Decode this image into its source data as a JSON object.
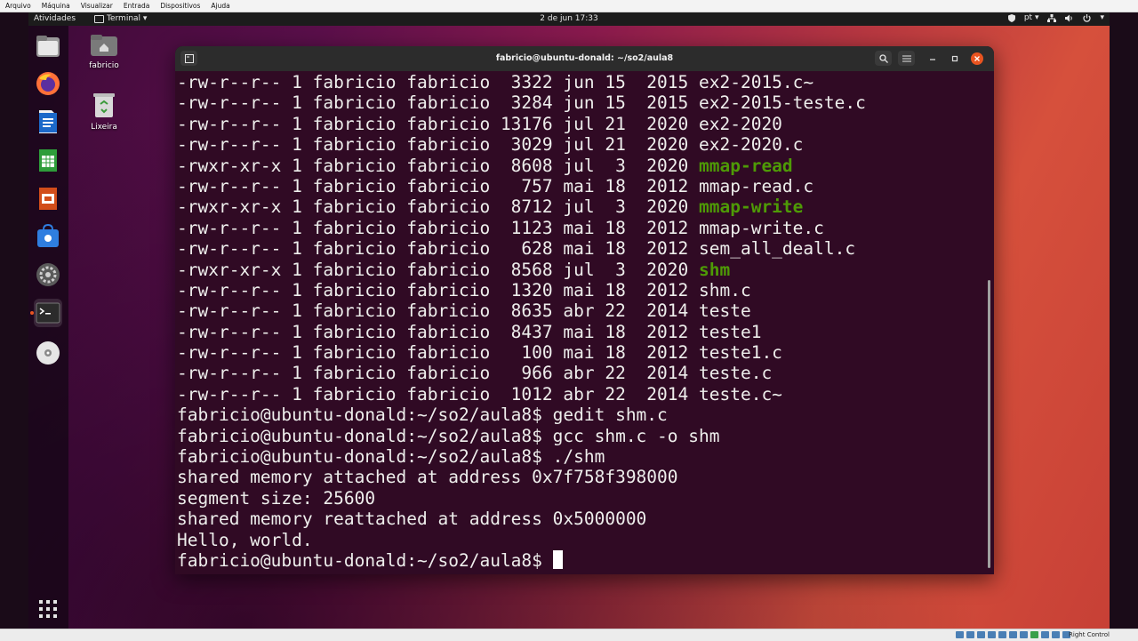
{
  "vbox": {
    "menu": [
      "Arquivo",
      "Máquina",
      "Visualizar",
      "Entrada",
      "Dispositivos",
      "Ajuda"
    ],
    "status_text": "Right Control"
  },
  "topbar": {
    "activities": "Atividades",
    "app_menu": "Terminal ▾",
    "clock": "2 de jun  17:33",
    "language": "pt ▾"
  },
  "desktop": {
    "home_label": "fabricio",
    "trash_label": "Lixeira"
  },
  "dock": {
    "items": [
      "files",
      "firefox",
      "writer",
      "calc",
      "impress",
      "software",
      "settings",
      "terminal",
      "dvd"
    ],
    "active": "terminal"
  },
  "terminal": {
    "title": "fabricio@ubuntu-donald: ~/so2/aula8",
    "listing": [
      {
        "perms": "-rw-r--r--",
        "links": "1",
        "owner": "fabricio",
        "group": "fabricio",
        "size": "3322",
        "month": "jun",
        "day": "15",
        "year": "2015",
        "name": "ex2-2015.c~",
        "exec": false
      },
      {
        "perms": "-rw-r--r--",
        "links": "1",
        "owner": "fabricio",
        "group": "fabricio",
        "size": "3284",
        "month": "jun",
        "day": "15",
        "year": "2015",
        "name": "ex2-2015-teste.c",
        "exec": false
      },
      {
        "perms": "-rw-r--r--",
        "links": "1",
        "owner": "fabricio",
        "group": "fabricio",
        "size": "13176",
        "month": "jul",
        "day": "21",
        "year": "2020",
        "name": "ex2-2020",
        "exec": false
      },
      {
        "perms": "-rw-r--r--",
        "links": "1",
        "owner": "fabricio",
        "group": "fabricio",
        "size": "3029",
        "month": "jul",
        "day": "21",
        "year": "2020",
        "name": "ex2-2020.c",
        "exec": false
      },
      {
        "perms": "-rwxr-xr-x",
        "links": "1",
        "owner": "fabricio",
        "group": "fabricio",
        "size": "8608",
        "month": "jul",
        "day": "3",
        "year": "2020",
        "name": "mmap-read",
        "exec": true
      },
      {
        "perms": "-rw-r--r--",
        "links": "1",
        "owner": "fabricio",
        "group": "fabricio",
        "size": "757",
        "month": "mai",
        "day": "18",
        "year": "2012",
        "name": "mmap-read.c",
        "exec": false
      },
      {
        "perms": "-rwxr-xr-x",
        "links": "1",
        "owner": "fabricio",
        "group": "fabricio",
        "size": "8712",
        "month": "jul",
        "day": "3",
        "year": "2020",
        "name": "mmap-write",
        "exec": true
      },
      {
        "perms": "-rw-r--r--",
        "links": "1",
        "owner": "fabricio",
        "group": "fabricio",
        "size": "1123",
        "month": "mai",
        "day": "18",
        "year": "2012",
        "name": "mmap-write.c",
        "exec": false
      },
      {
        "perms": "-rw-r--r--",
        "links": "1",
        "owner": "fabricio",
        "group": "fabricio",
        "size": "628",
        "month": "mai",
        "day": "18",
        "year": "2012",
        "name": "sem_all_deall.c",
        "exec": false
      },
      {
        "perms": "-rwxr-xr-x",
        "links": "1",
        "owner": "fabricio",
        "group": "fabricio",
        "size": "8568",
        "month": "jul",
        "day": "3",
        "year": "2020",
        "name": "shm",
        "exec": true
      },
      {
        "perms": "-rw-r--r--",
        "links": "1",
        "owner": "fabricio",
        "group": "fabricio",
        "size": "1320",
        "month": "mai",
        "day": "18",
        "year": "2012",
        "name": "shm.c",
        "exec": false
      },
      {
        "perms": "-rw-r--r--",
        "links": "1",
        "owner": "fabricio",
        "group": "fabricio",
        "size": "8635",
        "month": "abr",
        "day": "22",
        "year": "2014",
        "name": "teste",
        "exec": false
      },
      {
        "perms": "-rw-r--r--",
        "links": "1",
        "owner": "fabricio",
        "group": "fabricio",
        "size": "8437",
        "month": "mai",
        "day": "18",
        "year": "2012",
        "name": "teste1",
        "exec": false
      },
      {
        "perms": "-rw-r--r--",
        "links": "1",
        "owner": "fabricio",
        "group": "fabricio",
        "size": "100",
        "month": "mai",
        "day": "18",
        "year": "2012",
        "name": "teste1.c",
        "exec": false
      },
      {
        "perms": "-rw-r--r--",
        "links": "1",
        "owner": "fabricio",
        "group": "fabricio",
        "size": "966",
        "month": "abr",
        "day": "22",
        "year": "2014",
        "name": "teste.c",
        "exec": false
      },
      {
        "perms": "-rw-r--r--",
        "links": "1",
        "owner": "fabricio",
        "group": "fabricio",
        "size": "1012",
        "month": "abr",
        "day": "22",
        "year": "2014",
        "name": "teste.c~",
        "exec": false
      }
    ],
    "prompt": "fabricio@ubuntu-donald:~/so2/aula8$",
    "session": [
      {
        "prompt": true,
        "text": "gedit shm.c"
      },
      {
        "prompt": true,
        "text": "gcc shm.c -o shm"
      },
      {
        "prompt": true,
        "text": "./shm"
      },
      {
        "prompt": false,
        "text": "shared memory attached at address 0x7f758f398000"
      },
      {
        "prompt": false,
        "text": "segment size: 25600"
      },
      {
        "prompt": false,
        "text": "shared memory reattached at address 0x5000000"
      },
      {
        "prompt": false,
        "text": "Hello, world."
      }
    ],
    "colors": {
      "background": "#300a24",
      "foreground": "#eeeeec",
      "executable": "#4e9a06"
    }
  }
}
